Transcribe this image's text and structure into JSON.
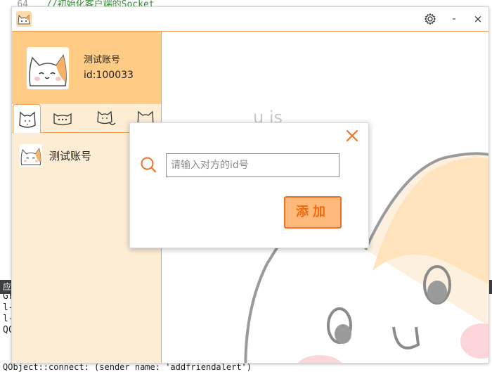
{
  "ide": {
    "top_line_number": "64",
    "top_line_code": "//初始化客户端的Socket",
    "left_tab": "应",
    "left_lines": [
      "c",
      "Gr",
      "l-",
      "l-",
      "QC"
    ],
    "bottom_line": "QObject::connect:  (sender name:   'addfriendalert')"
  },
  "window": {
    "titlebar": {
      "settings_icon": "gear-icon",
      "minimize_label": "-",
      "close_label": "×"
    },
    "profile": {
      "name": "测试账号",
      "id": "id:100033"
    },
    "tabs": [
      {
        "icon": "cat-face-icon"
      },
      {
        "icon": "chat-cat-icon"
      },
      {
        "icon": "cat-group-icon"
      },
      {
        "icon": "cat-outline-icon"
      }
    ],
    "contacts": [
      {
        "name": "测试账号"
      }
    ],
    "chat_background_text": "u is"
  },
  "dialog": {
    "search_placeholder": "请输入对方的id号",
    "add_label": "添加"
  },
  "colors": {
    "accent": "#f07020",
    "profile_bg": "#ffcb85",
    "sidebar_bg": "#fdedd5",
    "button_bg": "#ffb97a"
  }
}
